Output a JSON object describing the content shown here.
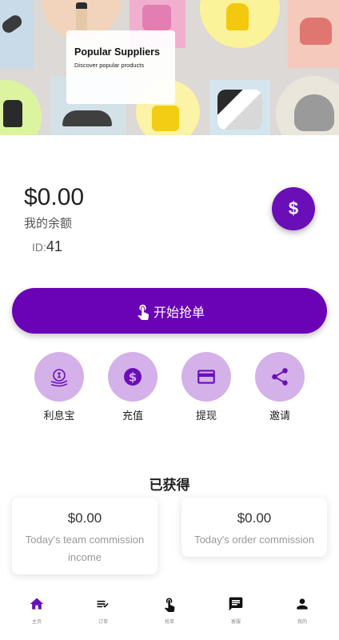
{
  "banner": {
    "title": "Popular Suppliers",
    "subtitle": "Discover popular products"
  },
  "account": {
    "balance": "$0.00",
    "balance_label": "我的余额",
    "id_prefix": "ID:",
    "id_value": "41",
    "currency_symbol": "$"
  },
  "grab": {
    "label": "开始抢单"
  },
  "actions": [
    {
      "label": "利息宝",
      "icon": "interest-icon"
    },
    {
      "label": "充值",
      "icon": "dollar-coin-icon"
    },
    {
      "label": "提现",
      "icon": "card-icon"
    },
    {
      "label": "邀请",
      "icon": "share-icon"
    }
  ],
  "earned": {
    "title": "已获得",
    "team": {
      "amount": "$0.00",
      "label": "Today's team commission income"
    },
    "order": {
      "amount": "$0.00",
      "label": "Today's order commission"
    }
  },
  "nav": [
    {
      "label": "主页",
      "icon": "home-icon",
      "active": true
    },
    {
      "label": "订单",
      "icon": "order-list-icon",
      "active": false
    },
    {
      "label": "抢单",
      "icon": "tap-icon",
      "active": false
    },
    {
      "label": "客服",
      "icon": "chat-icon",
      "active": false
    },
    {
      "label": "我的",
      "icon": "person-icon",
      "active": false
    }
  ],
  "colors": {
    "primary": "#6a02b5",
    "action_circle": "#d4b1e8",
    "nav_active": "#6a0fb8"
  }
}
